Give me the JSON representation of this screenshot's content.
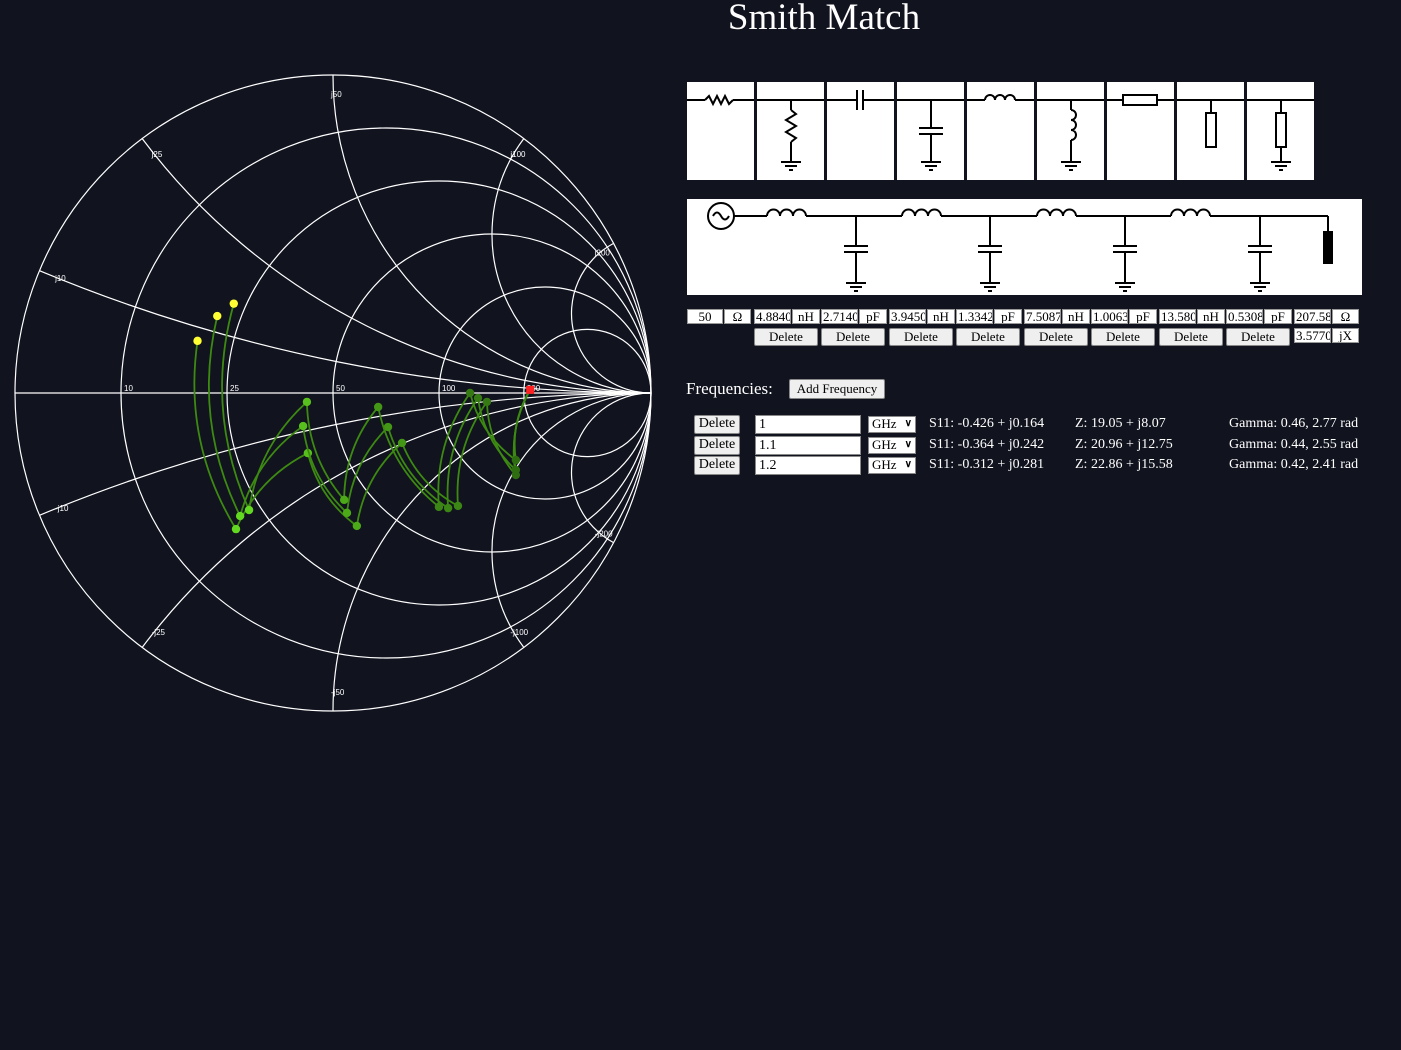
{
  "title": "Smith Match",
  "palette": {
    "items": [
      {
        "name": "series-resistor"
      },
      {
        "name": "shunt-resistor"
      },
      {
        "name": "series-capacitor"
      },
      {
        "name": "shunt-capacitor"
      },
      {
        "name": "series-inductor"
      },
      {
        "name": "shunt-inductor"
      },
      {
        "name": "series-transmission-line"
      },
      {
        "name": "open-stub"
      },
      {
        "name": "shorted-stub"
      }
    ]
  },
  "schematic": {
    "source_icon": "ac-source-icon",
    "chain": [
      "series-inductor",
      "shunt-capacitor",
      "series-inductor",
      "shunt-capacitor",
      "series-inductor",
      "shunt-capacitor",
      "series-inductor",
      "shunt-capacitor"
    ],
    "load_icon": "load-resistor-icon"
  },
  "source": {
    "value": "50",
    "unit": "Ω"
  },
  "components": [
    {
      "value": "4.8840",
      "unit": "nH",
      "delete": "Delete"
    },
    {
      "value": "2.7140",
      "unit": "pF",
      "delete": "Delete"
    },
    {
      "value": "3.9450",
      "unit": "nH",
      "delete": "Delete"
    },
    {
      "value": "1.3342",
      "unit": "pF",
      "delete": "Delete"
    },
    {
      "value": "7.5087",
      "unit": "nH",
      "delete": "Delete"
    },
    {
      "value": "1.0063",
      "unit": "pF",
      "delete": "Delete"
    },
    {
      "value": "13.580",
      "unit": "nH",
      "delete": "Delete"
    },
    {
      "value": "0.5308",
      "unit": "pF",
      "delete": "Delete"
    }
  ],
  "load": {
    "real": "207.58",
    "real_unit": "Ω",
    "imag": "3.5770",
    "imag_unit": "jX"
  },
  "frequencies": {
    "label": "Frequencies:",
    "add_label": "Add Frequency",
    "rows": [
      {
        "delete": "Delete",
        "value": "1",
        "unit": "GHz",
        "s11": "S11: -0.426 + j0.164",
        "z": "Z: 19.05 + j8.07",
        "gamma": "Gamma: 0.46, 2.77 rad"
      },
      {
        "delete": "Delete",
        "value": "1.1",
        "unit": "GHz",
        "s11": "S11: -0.364 + j0.242",
        "z": "Z: 20.96 + j12.75",
        "gamma": "Gamma: 0.44, 2.55 rad"
      },
      {
        "delete": "Delete",
        "value": "1.2",
        "unit": "GHz",
        "s11": "S11: -0.312 + j0.281",
        "z": "Z: 22.86 + j15.58",
        "gamma": "Gamma: 0.42, 2.41 rad"
      }
    ]
  },
  "chart_data": {
    "type": "smith",
    "z0": 50,
    "resistance_circles": [
      10,
      25,
      50,
      100,
      200
    ],
    "resistance_labels": [
      "10",
      "25",
      "50",
      "100",
      "200"
    ],
    "reactance_arcs": [
      10,
      25,
      50,
      100,
      200
    ],
    "reactance_labels_pos": [
      "j10",
      "j25",
      "j50",
      "j100",
      "j200"
    ],
    "reactance_labels_neg": [
      "-j10",
      "-j25",
      "-j50",
      "-j100",
      "-j200"
    ],
    "load_gamma": [
      0.62,
      0.01
    ],
    "colors": {
      "grid": "#ffffff",
      "load": "#ff2222",
      "trace": "#3d8a12",
      "end": "#ffff33"
    },
    "traces": [
      {
        "frequency": "1 GHz",
        "gamma": [
          [
            0.575,
            -0.258
          ],
          [
            0.484,
            -0.028
          ],
          [
            0.393,
            -0.355
          ],
          [
            0.217,
            -0.157
          ],
          [
            0.075,
            -0.418
          ],
          [
            -0.079,
            -0.189
          ],
          [
            -0.305,
            -0.428
          ],
          [
            -0.426,
            0.164
          ]
        ]
      },
      {
        "frequency": "1.1 GHz",
        "gamma": [
          [
            0.575,
            -0.242
          ],
          [
            0.456,
            -0.016
          ],
          [
            0.362,
            -0.362
          ],
          [
            0.173,
            -0.107
          ],
          [
            0.044,
            -0.377
          ],
          [
            -0.094,
            -0.104
          ],
          [
            -0.292,
            -0.387
          ],
          [
            -0.364,
            0.242
          ]
        ]
      },
      {
        "frequency": "1.2 GHz",
        "gamma": [
          [
            0.575,
            -0.211
          ],
          [
            0.431,
            0.0
          ],
          [
            0.333,
            -0.358
          ],
          [
            0.142,
            -0.044
          ],
          [
            0.035,
            -0.336
          ],
          [
            -0.082,
            -0.028
          ],
          [
            -0.264,
            -0.368
          ],
          [
            -0.312,
            0.281
          ]
        ]
      }
    ]
  }
}
